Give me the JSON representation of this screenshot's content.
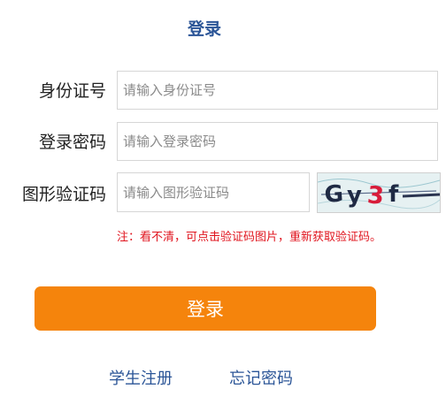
{
  "header": {
    "title": "登录"
  },
  "form": {
    "id_number": {
      "label": "身份证号",
      "placeholder": "请输入身份证号",
      "value": ""
    },
    "password": {
      "label": "登录密码",
      "placeholder": "请输入登录密码",
      "value": ""
    },
    "captcha": {
      "label": "图形验证码",
      "placeholder": "请输入图形验证码",
      "value": "",
      "image_text": "Gy3f"
    },
    "hint": "注：看不清，可点击验证码图片，重新获取验证码。",
    "submit_label": "登录"
  },
  "links": {
    "register": "学生注册",
    "forgot_password": "忘记密码"
  },
  "colors": {
    "title": "#2b5597",
    "button": "#f5840c",
    "hint": "#e0141e",
    "link": "#2b5597"
  }
}
